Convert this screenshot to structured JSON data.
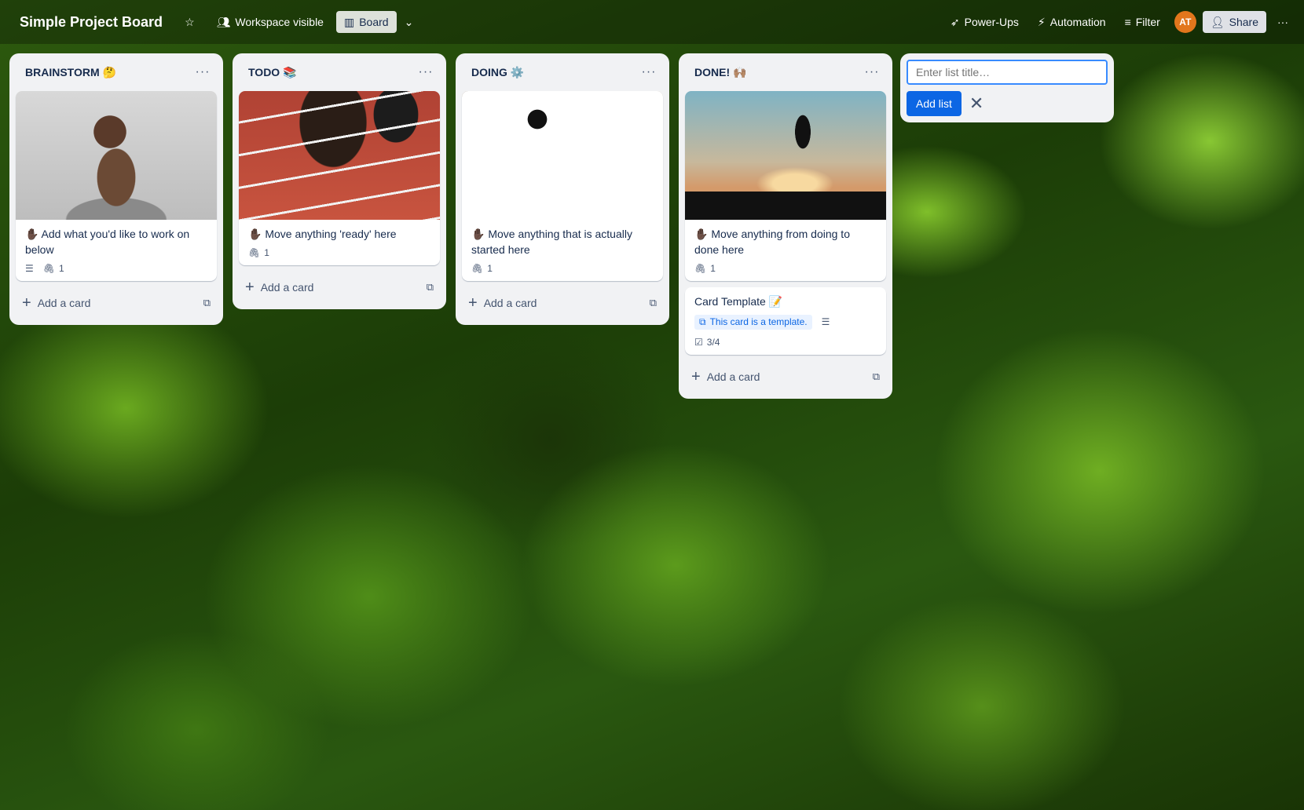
{
  "topbar": {
    "title": "Simple Project Board",
    "visibility": "Workspace visible",
    "view": "Board",
    "powerups": "Power-Ups",
    "automation": "Automation",
    "filter": "Filter",
    "avatar_initials": "AT",
    "share": "Share"
  },
  "lists": [
    {
      "title": "BRAINSTORM 🤔",
      "card_text": "✋🏿 Add what you'd like to work on below",
      "attachments": "1",
      "add_card": "Add a card"
    },
    {
      "title": "TODO 📚",
      "card_text": "✋🏿 Move anything 'ready' here",
      "attachments": "1",
      "add_card": "Add a card"
    },
    {
      "title": "DOING ⚙️",
      "card_text": "✋🏿 Move anything that is actually started here",
      "attachments": "1",
      "add_card": "Add a card"
    },
    {
      "title": "DONE! 🙌🏽",
      "card_text": "✋🏿 Move anything from doing to done here",
      "attachments": "1",
      "template_card": {
        "title": "Card Template 📝",
        "template_badge": "This card is a template.",
        "checklist": "3/4"
      },
      "add_card": "Add a card"
    }
  ],
  "add_list": {
    "placeholder": "Enter list title…",
    "button": "Add list"
  }
}
